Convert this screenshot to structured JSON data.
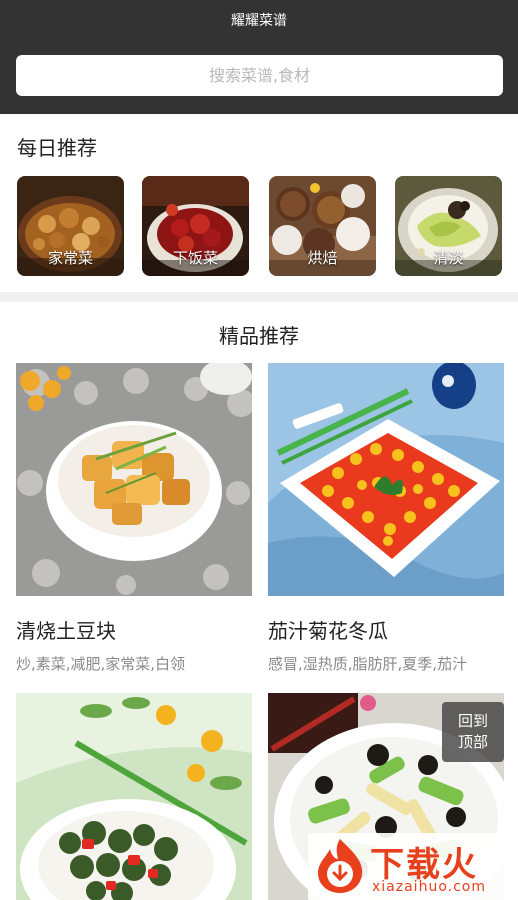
{
  "app": {
    "title": "耀耀菜谱"
  },
  "search": {
    "placeholder": "搜索菜谱,食材",
    "value": ""
  },
  "daily": {
    "title": "每日推荐",
    "categories": [
      {
        "label": "家常菜"
      },
      {
        "label": "下饭菜"
      },
      {
        "label": "烘焙"
      },
      {
        "label": "清淡"
      }
    ]
  },
  "featured": {
    "title": "精品推荐",
    "recipes": [
      {
        "name": "清烧土豆块",
        "tags": "炒,素菜,减肥,家常菜,白领"
      },
      {
        "name": "茄汁菊花冬瓜",
        "tags": "感冒,湿热质,脂肪肝,夏季,茄汁"
      },
      {
        "name": "",
        "tags": ""
      },
      {
        "name": "",
        "tags": ""
      }
    ]
  },
  "back_to_top": {
    "line1": "回到",
    "line2": "顶部"
  },
  "watermark": {
    "brand": "下载火",
    "url": "xiazaihuo.com",
    "logo_icon": "flame-download-icon"
  }
}
